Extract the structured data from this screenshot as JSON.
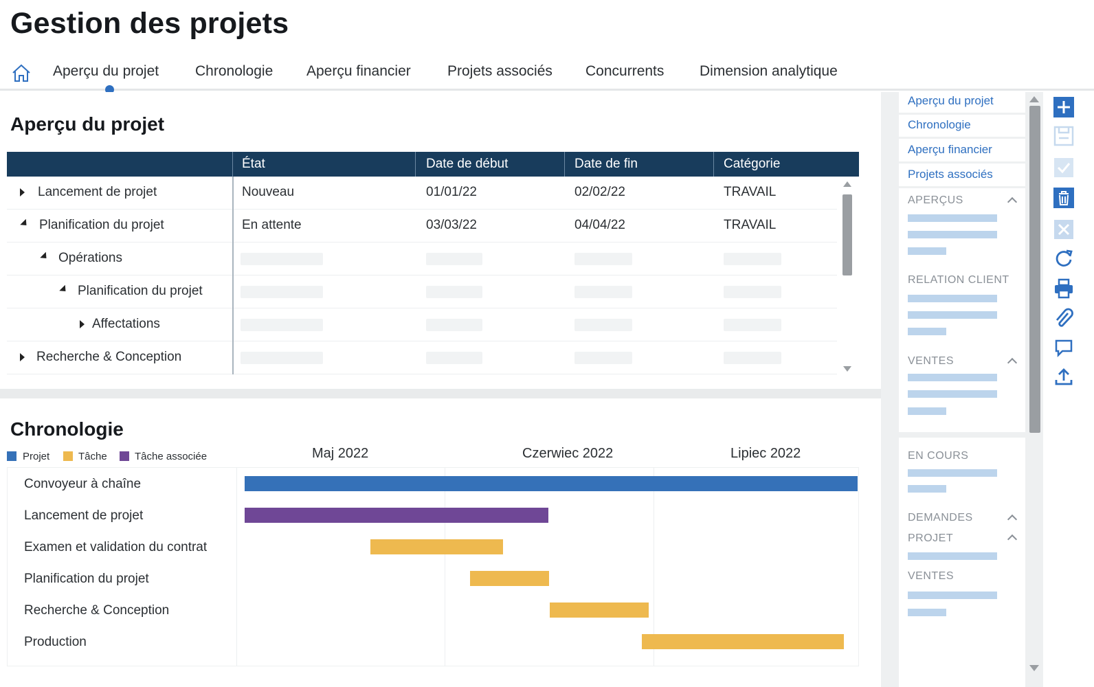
{
  "app": {
    "title": "Gestion des projets"
  },
  "tabs": [
    {
      "label": "Aperçu du projet"
    },
    {
      "label": "Chronologie"
    },
    {
      "label": "Aperçu financier"
    },
    {
      "label": "Projets associés"
    },
    {
      "label": "Concurrents"
    },
    {
      "label": "Dimension analytique"
    }
  ],
  "overview": {
    "title": "Aperçu du projet",
    "columns": [
      "",
      "État",
      "Date de début",
      "Date de fin",
      "Catégorie"
    ],
    "rows": [
      {
        "name": "Lancement de projet",
        "state": "Nouveau",
        "start": "01/01/22",
        "end": "02/02/22",
        "category": "TRAVAIL",
        "expanded": false
      },
      {
        "name": "Planification du projet",
        "state": "En attente",
        "start": "03/03/22",
        "end": "04/04/22",
        "category": "TRAVAIL",
        "expanded": true
      },
      {
        "name": "Opérations",
        "expanded": true
      },
      {
        "name": "Planification du projet",
        "expanded": true
      },
      {
        "name": "Affectations",
        "expanded": false
      },
      {
        "name": "Recherche & Conception",
        "expanded": false
      }
    ]
  },
  "timeline": {
    "title": "Chronologie",
    "legend": [
      {
        "label": "Projet",
        "color": "#3571b8"
      },
      {
        "label": "Tâche",
        "color": "#eeb94f"
      },
      {
        "label": "Tâche associée",
        "color": "#6f4796"
      }
    ],
    "months": [
      "Maj 2022",
      "Czerwiec 2022",
      "Lipiec 2022"
    ],
    "tasks": [
      {
        "name": "Convoyeur à chaîne",
        "kind": "Projet",
        "start": 0.0,
        "end": 1.0
      },
      {
        "name": "Lancement de projet",
        "kind": "Tâche associée",
        "start": 0.0,
        "end": 0.496
      },
      {
        "name": "Examen et validation du contrat",
        "kind": "Tâche",
        "start": 0.205,
        "end": 0.421
      },
      {
        "name": "Planification du projet",
        "kind": "Tâche",
        "start": 0.368,
        "end": 0.497
      },
      {
        "name": "Recherche & Conception",
        "kind": "Tâche",
        "start": 0.498,
        "end": 0.659
      },
      {
        "name": "Production",
        "kind": "Tâche",
        "start": 0.648,
        "end": 0.978
      }
    ]
  },
  "side_nav": {
    "links": [
      "Aperçu du projet",
      "Chronologie",
      "Aperçu financier",
      "Projets associés"
    ],
    "sections": [
      {
        "label": "APERÇUS",
        "collapsible": true
      },
      {
        "label": "RELATION CLIENT",
        "collapsible": false
      },
      {
        "label": "VENTES",
        "collapsible": true
      },
      {
        "label": "EN COURS",
        "collapsible": false
      },
      {
        "label": "DEMANDES",
        "collapsible": true
      },
      {
        "label": "PROJET",
        "collapsible": true
      },
      {
        "label": "VENTES",
        "collapsible": false
      }
    ]
  },
  "toolbar": {
    "icons": [
      "add-icon",
      "save-icon",
      "checkmark-icon",
      "delete-icon",
      "close-icon",
      "refresh-icon",
      "print-icon",
      "attach-icon",
      "comment-icon",
      "upload-icon"
    ]
  },
  "colors": {
    "accent": "#2e6fc0",
    "header": "#183c5c",
    "project": "#3571b8",
    "task": "#eeb94f",
    "linked": "#6f4796"
  }
}
